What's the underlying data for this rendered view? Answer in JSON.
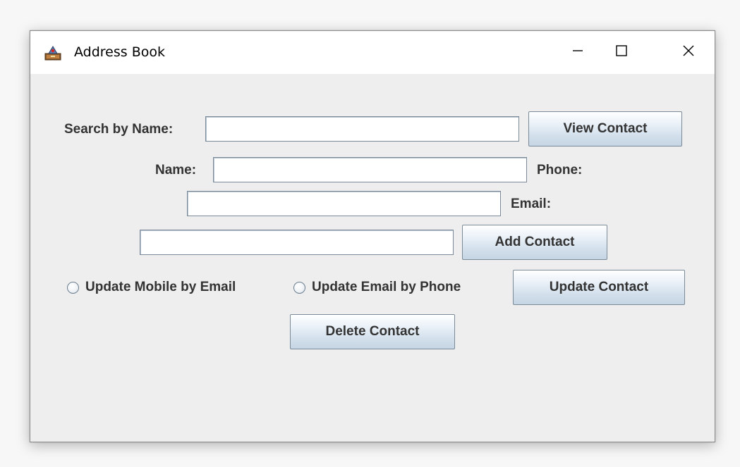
{
  "window": {
    "title": "Address Book",
    "controls": {
      "minimize_icon": "minimize-icon",
      "maximize_icon": "maximize-icon",
      "close_icon": "close-icon"
    }
  },
  "form": {
    "search_label": "Search by Name:",
    "search_value": "",
    "view_button": "View Contact",
    "name_label": "Name:",
    "name_value": "",
    "phone_label": "Phone:",
    "phone_value": "",
    "email_label": "Email:",
    "email_value": "",
    "add_button": "Add Contact",
    "radio_mobile_by_email": "Update Mobile by Email",
    "radio_mobile_by_email_selected": false,
    "radio_email_by_phone": "Update Email by Phone",
    "radio_email_by_phone_selected": false,
    "update_button": "Update Contact",
    "delete_button": "Delete Contact"
  },
  "colors": {
    "window_bg": "#eeeeee",
    "text": "#333333",
    "button_border": "#7a8a99"
  }
}
